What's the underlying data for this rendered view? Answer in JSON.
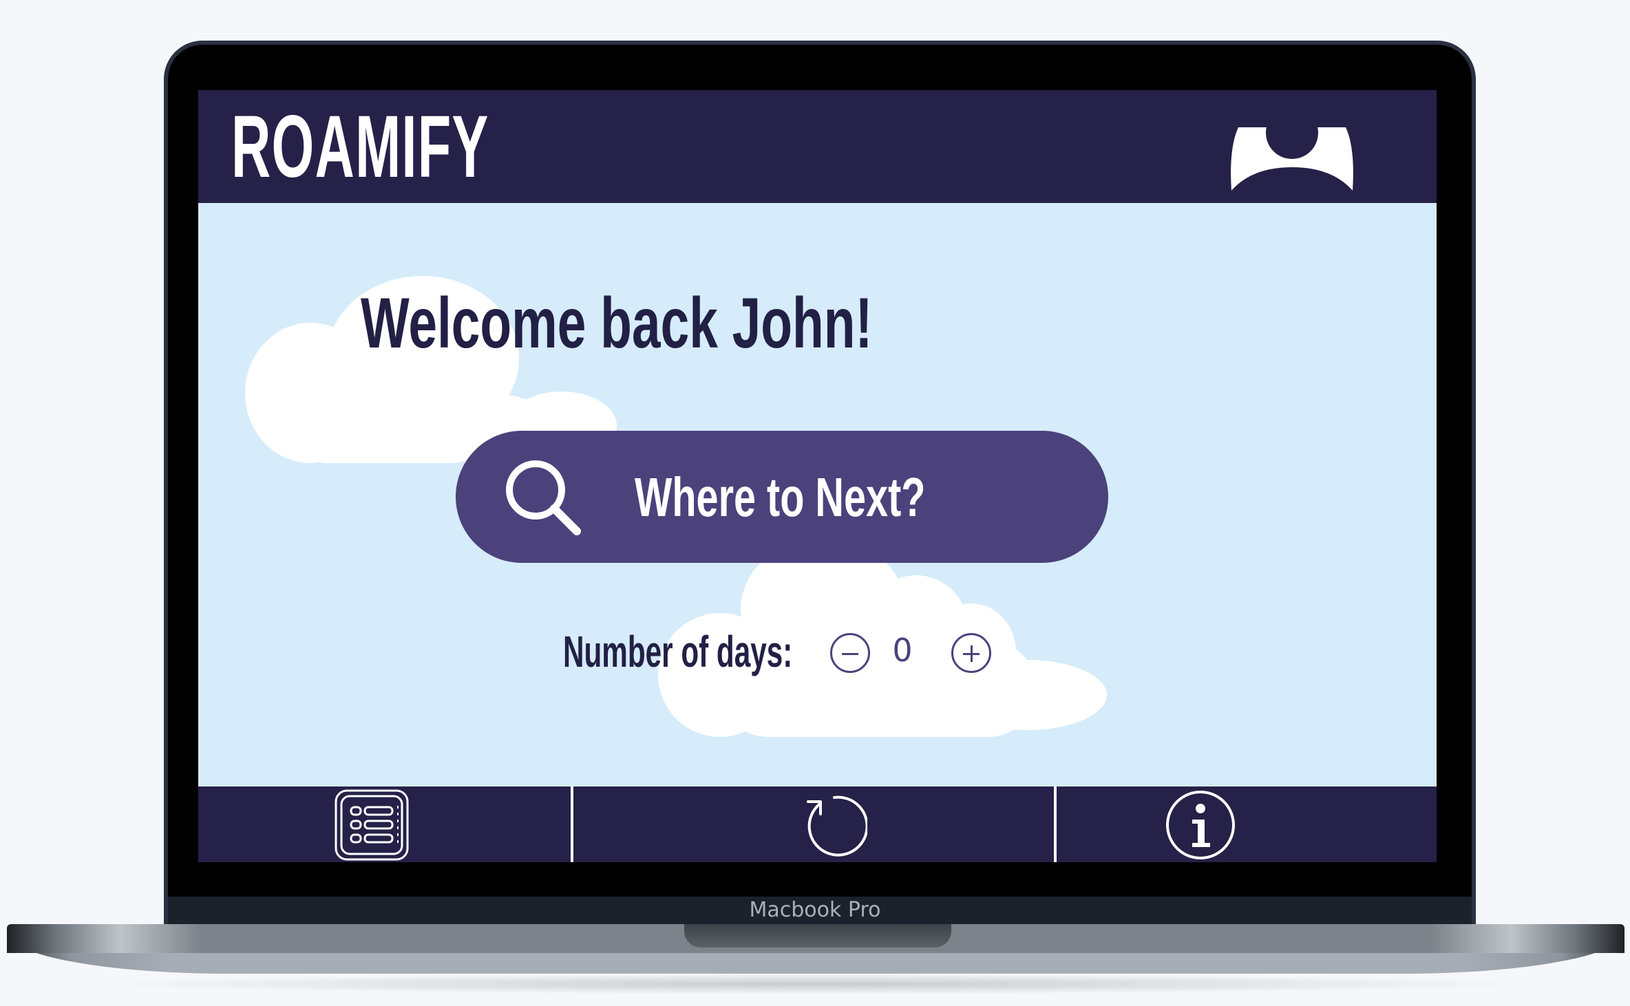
{
  "app": {
    "logo": "ROAMIFY",
    "welcome": "Welcome back John!"
  },
  "search": {
    "label": "Where to Next?",
    "icon": "search-icon"
  },
  "days": {
    "label": "Number of days:",
    "value": "0",
    "decrement_icon": "minus-circle-icon",
    "increment_icon": "plus-circle-icon"
  },
  "nav": {
    "items": [
      {
        "icon": "list-icon"
      },
      {
        "icon": "refresh-icon"
      },
      {
        "icon": "info-icon"
      }
    ]
  },
  "device": {
    "label": "Macbook Pro"
  },
  "colors": {
    "header": "#252148",
    "background": "#d6ecfa",
    "accent": "#4b427c",
    "text_dark": "#222045"
  }
}
